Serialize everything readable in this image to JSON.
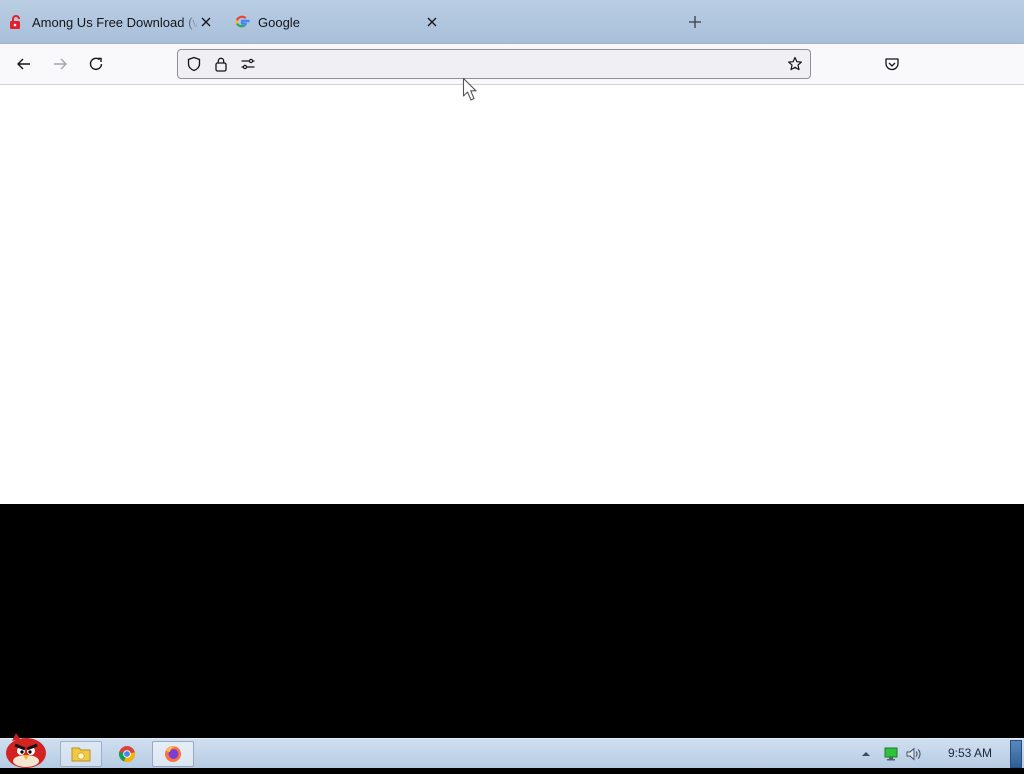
{
  "browser": {
    "tabs": [
      {
        "title": "Among Us Free Download (v",
        "favicon": "red-lock-icon",
        "active": false
      },
      {
        "title": "Google",
        "favicon": "google-g-icon",
        "active": false
      }
    ],
    "newtab_icon": "plus-icon",
    "toolbar": {
      "back_icon": "arrow-left-icon",
      "forward_icon": "arrow-right-icon",
      "reload_icon": "reload-icon",
      "url_value": "",
      "url_icons": [
        "shield-icon",
        "lock-icon",
        "permissions-icon"
      ],
      "bookmark_icon": "star-icon",
      "pocket_icon": "pocket-icon"
    }
  },
  "taskbar": {
    "start_icon": "angry-bird-start-icon",
    "pinned": [
      "file-explorer-icon",
      "chrome-icon",
      "firefox-icon"
    ],
    "tray": [
      "tray-arrow-up-icon",
      "network-icon",
      "volume-icon"
    ],
    "clock": "9:53 AM"
  },
  "colors": {
    "tabstrip": "#b9cde3",
    "toolbar": "#f9f9fb",
    "content": "#ffffff",
    "taskbar": "#c4d6ea"
  }
}
